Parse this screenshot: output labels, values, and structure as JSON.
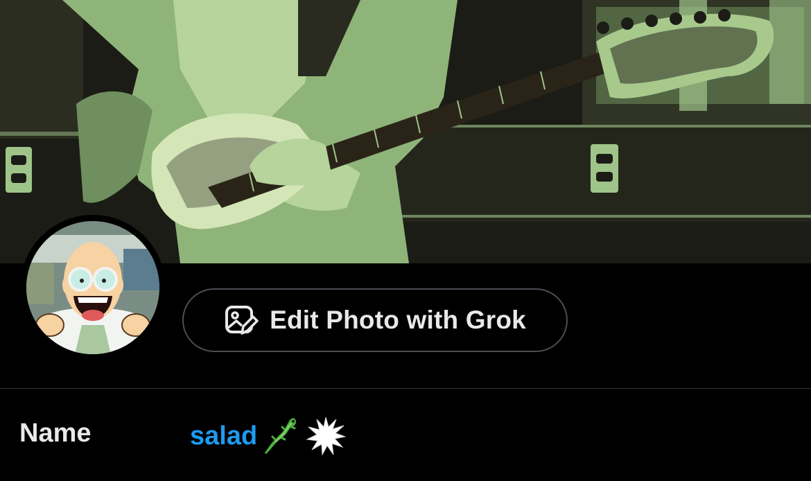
{
  "header": {
    "banner_icon": "guitar-photo-banner",
    "banner_colors": {
      "light": "#9fc48a",
      "dark": "#1c1c16"
    }
  },
  "profile": {
    "avatar_icon": "cartoon-professor-avatar"
  },
  "edit_button": {
    "label": "Edit Photo with Grok",
    "icon": "image-edit-icon"
  },
  "fields": {
    "name": {
      "label": "Name",
      "value": "salad",
      "emojis": [
        "lizard-emoji",
        "spark-burst-emoji"
      ],
      "value_color": "#1d9bf0"
    }
  },
  "colors": {
    "background": "#000000",
    "text": "#e7e9ea",
    "accent": "#1d9bf0",
    "border": "#4a4f55"
  }
}
